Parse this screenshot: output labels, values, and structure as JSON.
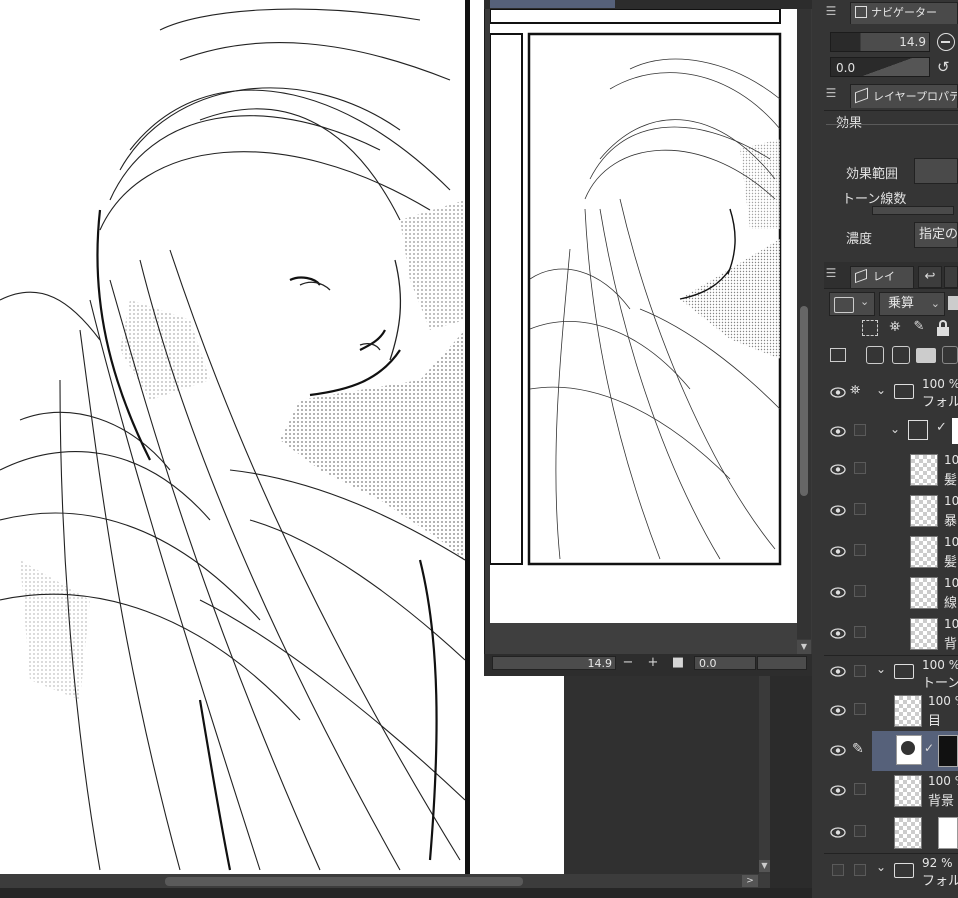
{
  "navigator": {
    "tab_label": "ナビゲーター",
    "zoom_value": "14.9",
    "rotate_value": "0.0"
  },
  "layer_property": {
    "tab_label": "レイヤープロパティ",
    "section_label": "効果",
    "effect_range_label": "効果範囲",
    "tone_lines_label": "トーン線数",
    "density_label": "濃度",
    "density_value": "指定の"
  },
  "layer_panel": {
    "tab_label": "レイ",
    "blend_mode": "乗算",
    "layers": [
      {
        "percent": "100 %",
        "name": "フォルダ",
        "type": "folder"
      },
      {
        "percent": "",
        "name": "",
        "type": "sublayer-group"
      },
      {
        "percent": "10",
        "name": "髪",
        "type": "raster"
      },
      {
        "percent": "10",
        "name": "暴",
        "type": "raster"
      },
      {
        "percent": "10",
        "name": "髪",
        "type": "raster"
      },
      {
        "percent": "10",
        "name": "線",
        "type": "raster"
      },
      {
        "percent": "10",
        "name": "背",
        "type": "raster"
      },
      {
        "percent": "100 %",
        "name": "トーン",
        "type": "folder"
      },
      {
        "percent": "100 %",
        "name": "目",
        "type": "raster"
      },
      {
        "percent": "",
        "name": "",
        "type": "tone-selected"
      },
      {
        "percent": "100 %",
        "name": "背景",
        "type": "raster"
      },
      {
        "percent": "",
        "name": "",
        "type": "mask"
      },
      {
        "percent": "92 %",
        "name": "フォルダ",
        "type": "folder"
      }
    ]
  },
  "sub_window": {
    "zoom_value": "14.9",
    "rotate_value": "0.0",
    "minus_label": "−",
    "plus_label": "+"
  },
  "colors": {
    "panel_bg": "#353535",
    "selected_row": "#56617a",
    "canvas_bg": "#ffffff"
  }
}
